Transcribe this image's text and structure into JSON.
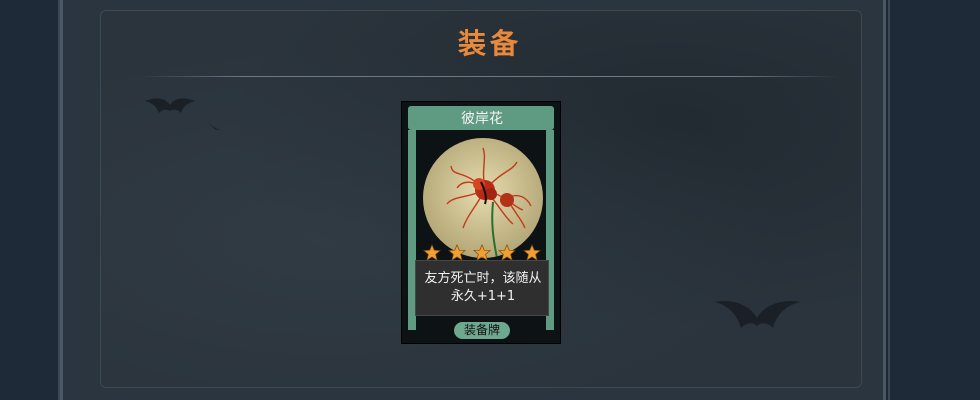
{
  "header": {
    "title": "装备"
  },
  "card": {
    "name": "彼岸花",
    "description_line1": "友方死亡时，该随从",
    "description_line2": "永久+1+1",
    "type_label": "装备牌",
    "stars": 5,
    "art_icon": "red-spider-lily-icon",
    "colors": {
      "frame": "#5f9a83",
      "star": "#f0a030",
      "title_text": "#e8893b"
    }
  }
}
